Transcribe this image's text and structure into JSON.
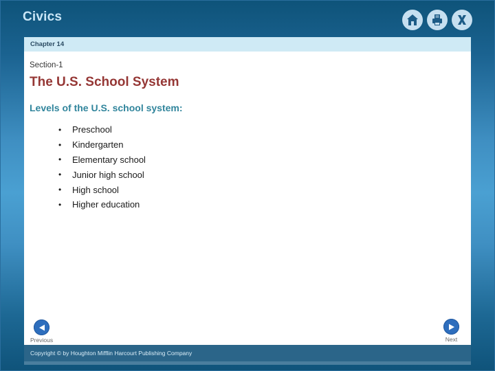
{
  "app": {
    "title": "Civics"
  },
  "toolbar": {
    "home_icon": "home-icon",
    "print_icon": "printer-icon",
    "close_icon": "close-x-icon"
  },
  "chapter": {
    "label": "Chapter 14"
  },
  "slide": {
    "section": "Section-1",
    "title": "The U.S. School System",
    "subheading": "Levels of the U.S. school system:",
    "bullets": [
      "Preschool",
      "Kindergarten",
      "Elementary school",
      "Junior high school",
      "High school",
      "Higher education"
    ]
  },
  "nav": {
    "previous_label": "Previous",
    "next_label": "Next"
  },
  "footer": {
    "copyright": "Copyright © by Houghton Mifflin Harcourt Publishing Company"
  },
  "colors": {
    "title": "#953735",
    "subheading": "#31859c",
    "chapter_bar": "#cfeaf5",
    "nav_button": "#2e6ebd",
    "footer": "#2b6589"
  }
}
